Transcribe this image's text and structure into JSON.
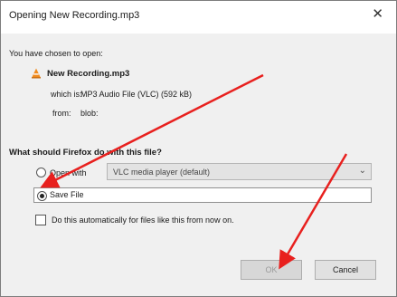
{
  "dialog": {
    "title": "Opening New Recording.mp3",
    "close_glyph": "✕",
    "intro": "You have chosen to open:",
    "file_icon": "vlc-cone-icon",
    "filename": "New Recording.mp3",
    "which_label": "which is:",
    "which_value": "MP3 Audio File (VLC) (592 kB)",
    "from_label": "from:",
    "from_value": "blob:",
    "question": "What should Firefox do with this file?",
    "open_with": {
      "label": "Open with",
      "selected": false,
      "app": "VLC media player (default)",
      "chevron": "⌄"
    },
    "save_file": {
      "label": "Save File",
      "selected": true
    },
    "auto_checkbox": {
      "label": "Do this automatically for files like this from now on.",
      "checked": false
    },
    "buttons": {
      "ok": "OK",
      "cancel": "Cancel"
    }
  },
  "colors": {
    "annotation_arrow": "#e8201e",
    "dialog_bg": "#f0f0f0",
    "vlc_orange": "#f08a1c"
  }
}
